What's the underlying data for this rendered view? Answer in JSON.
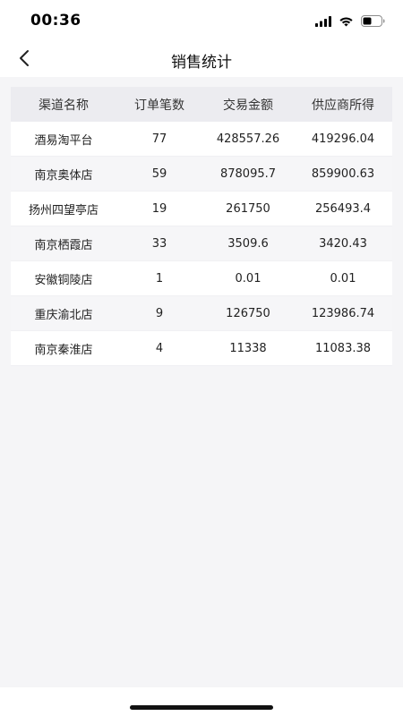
{
  "status_bar": {
    "time": "00:36"
  },
  "nav": {
    "title": "销售统计",
    "back_icon": "chevron-left-icon"
  },
  "table": {
    "headers": [
      "渠道名称",
      "订单笔数",
      "交易金额",
      "供应商所得"
    ],
    "rows": [
      [
        "酒易淘平台",
        "77",
        "428557.26",
        "419296.04"
      ],
      [
        "南京奥体店",
        "59",
        "878095.7",
        "859900.63"
      ],
      [
        "扬州四望亭店",
        "19",
        "261750",
        "256493.4"
      ],
      [
        "南京栖霞店",
        "33",
        "3509.6",
        "3420.43"
      ],
      [
        "安徽铜陵店",
        "1",
        "0.01",
        "0.01"
      ],
      [
        "重庆渝北店",
        "9",
        "126750",
        "123986.74"
      ],
      [
        "南京秦淮店",
        "4",
        "11338",
        "11083.38"
      ]
    ]
  }
}
